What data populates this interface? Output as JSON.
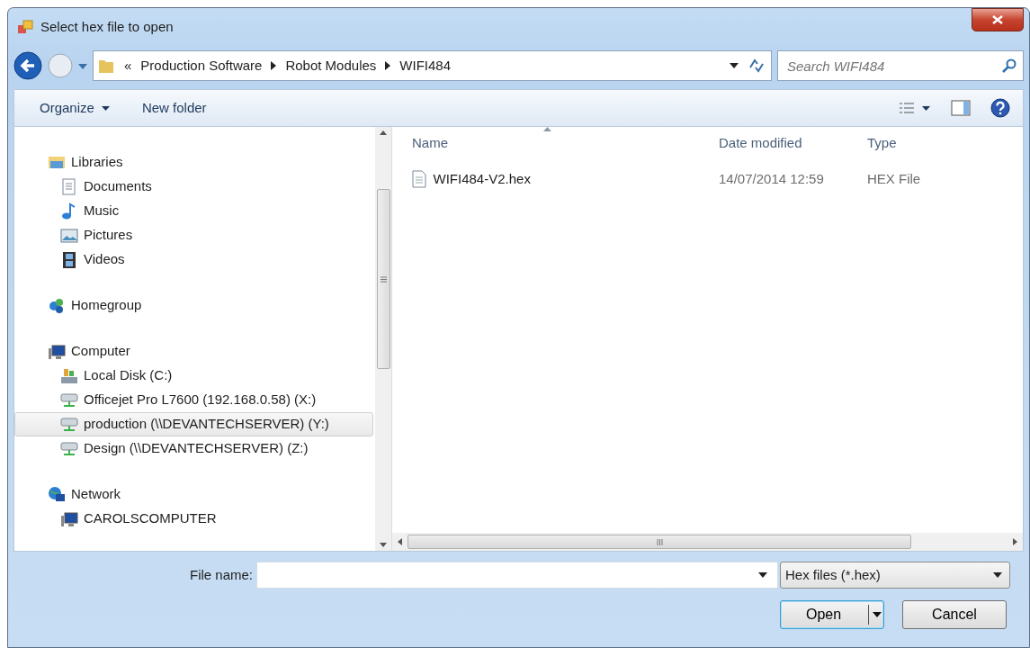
{
  "window": {
    "title": "Select hex file to open"
  },
  "address": {
    "overflow": "«",
    "crumbs": [
      "Production Software",
      "Robot Modules",
      "WIFI484"
    ]
  },
  "search": {
    "placeholder": "Search WIFI484"
  },
  "toolbar": {
    "buttons": [
      {
        "label": "Organize",
        "kind": "menu"
      },
      {
        "label": "New folder",
        "kind": "plain"
      }
    ]
  },
  "nav": {
    "groups": [
      {
        "label": "Libraries",
        "kind": "libraries",
        "selected": false,
        "children": [
          {
            "label": "Documents",
            "kind": "documents",
            "selected": false
          },
          {
            "label": "Music",
            "kind": "music",
            "selected": false
          },
          {
            "label": "Pictures",
            "kind": "pictures",
            "selected": false
          },
          {
            "label": "Videos",
            "kind": "videos",
            "selected": false
          }
        ]
      },
      {
        "label": "Homegroup",
        "kind": "homegroup",
        "selected": false
      },
      {
        "label": "Computer",
        "kind": "computer",
        "selected": false,
        "children": [
          {
            "label": "Local Disk (C:)",
            "kind": "disk",
            "selected": false
          },
          {
            "label": "Officejet Pro L7600 (192.168.0.58) (X:)",
            "kind": "netdrive",
            "selected": false
          },
          {
            "label": "production (\\\\DEVANTECHSERVER) (Y:)",
            "kind": "netdrive",
            "selected": true
          },
          {
            "label": "Design (\\\\DEVANTECHSERVER) (Z:)",
            "kind": "netdrive",
            "selected": false
          }
        ]
      },
      {
        "label": "Network",
        "kind": "network",
        "selected": false,
        "children": [
          {
            "label": "CAROLSCOMPUTER",
            "kind": "computer",
            "selected": false
          }
        ]
      }
    ]
  },
  "files": {
    "columns": [
      {
        "label": "Name",
        "sorted": true
      },
      {
        "label": "Date modified",
        "sorted": false
      },
      {
        "label": "Type",
        "sorted": false
      }
    ],
    "rows": [
      {
        "name": "WIFI484-V2.hex",
        "date_modified": "14/07/2014 12:59",
        "type": "HEX File",
        "selected": false
      }
    ]
  },
  "file_name": {
    "label": "File name:"
  },
  "file_type": {
    "value": "Hex files (*.hex)"
  },
  "buttons": [
    {
      "label": "Open",
      "kind": "split",
      "default": true
    },
    {
      "label": "Cancel",
      "kind": "plain",
      "default": false
    }
  ]
}
